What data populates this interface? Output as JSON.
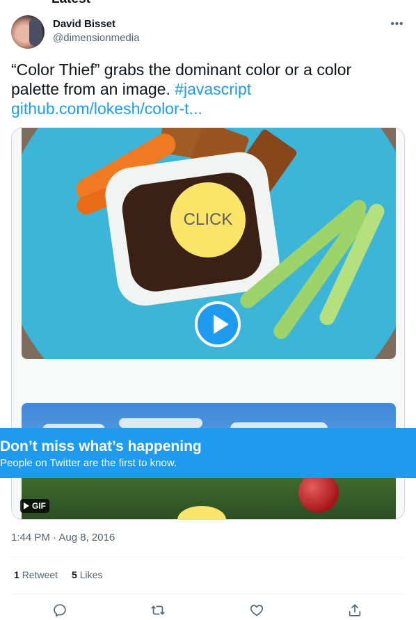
{
  "section_title": "Latest",
  "tweet": {
    "author_name": "David Bisset",
    "author_handle": "@dimensionmedia",
    "text_main": "“Color Thief” grabs the dominant color or a color palette from an image.",
    "hashtag": "#javascript",
    "link": "github.com/lokesh/color-t...",
    "media": {
      "overlay_text": "CLICK",
      "badge": "GIF"
    },
    "timestamp": "1:44 PM · Aug 8, 2016",
    "retweets_count": "1",
    "retweets_label": "Retweet",
    "likes_count": "5",
    "likes_label": "Likes"
  },
  "banner": {
    "title": "Don’t miss what’s happening",
    "subtitle": "People on Twitter are the first to know."
  },
  "colors": {
    "accent": "#1d9bf0",
    "text": "#0f1419",
    "secondary": "#536471"
  },
  "icons": [
    "more-icon",
    "play-icon",
    "gif-play-icon",
    "reply-icon",
    "retweet-icon",
    "like-icon",
    "share-icon"
  ]
}
